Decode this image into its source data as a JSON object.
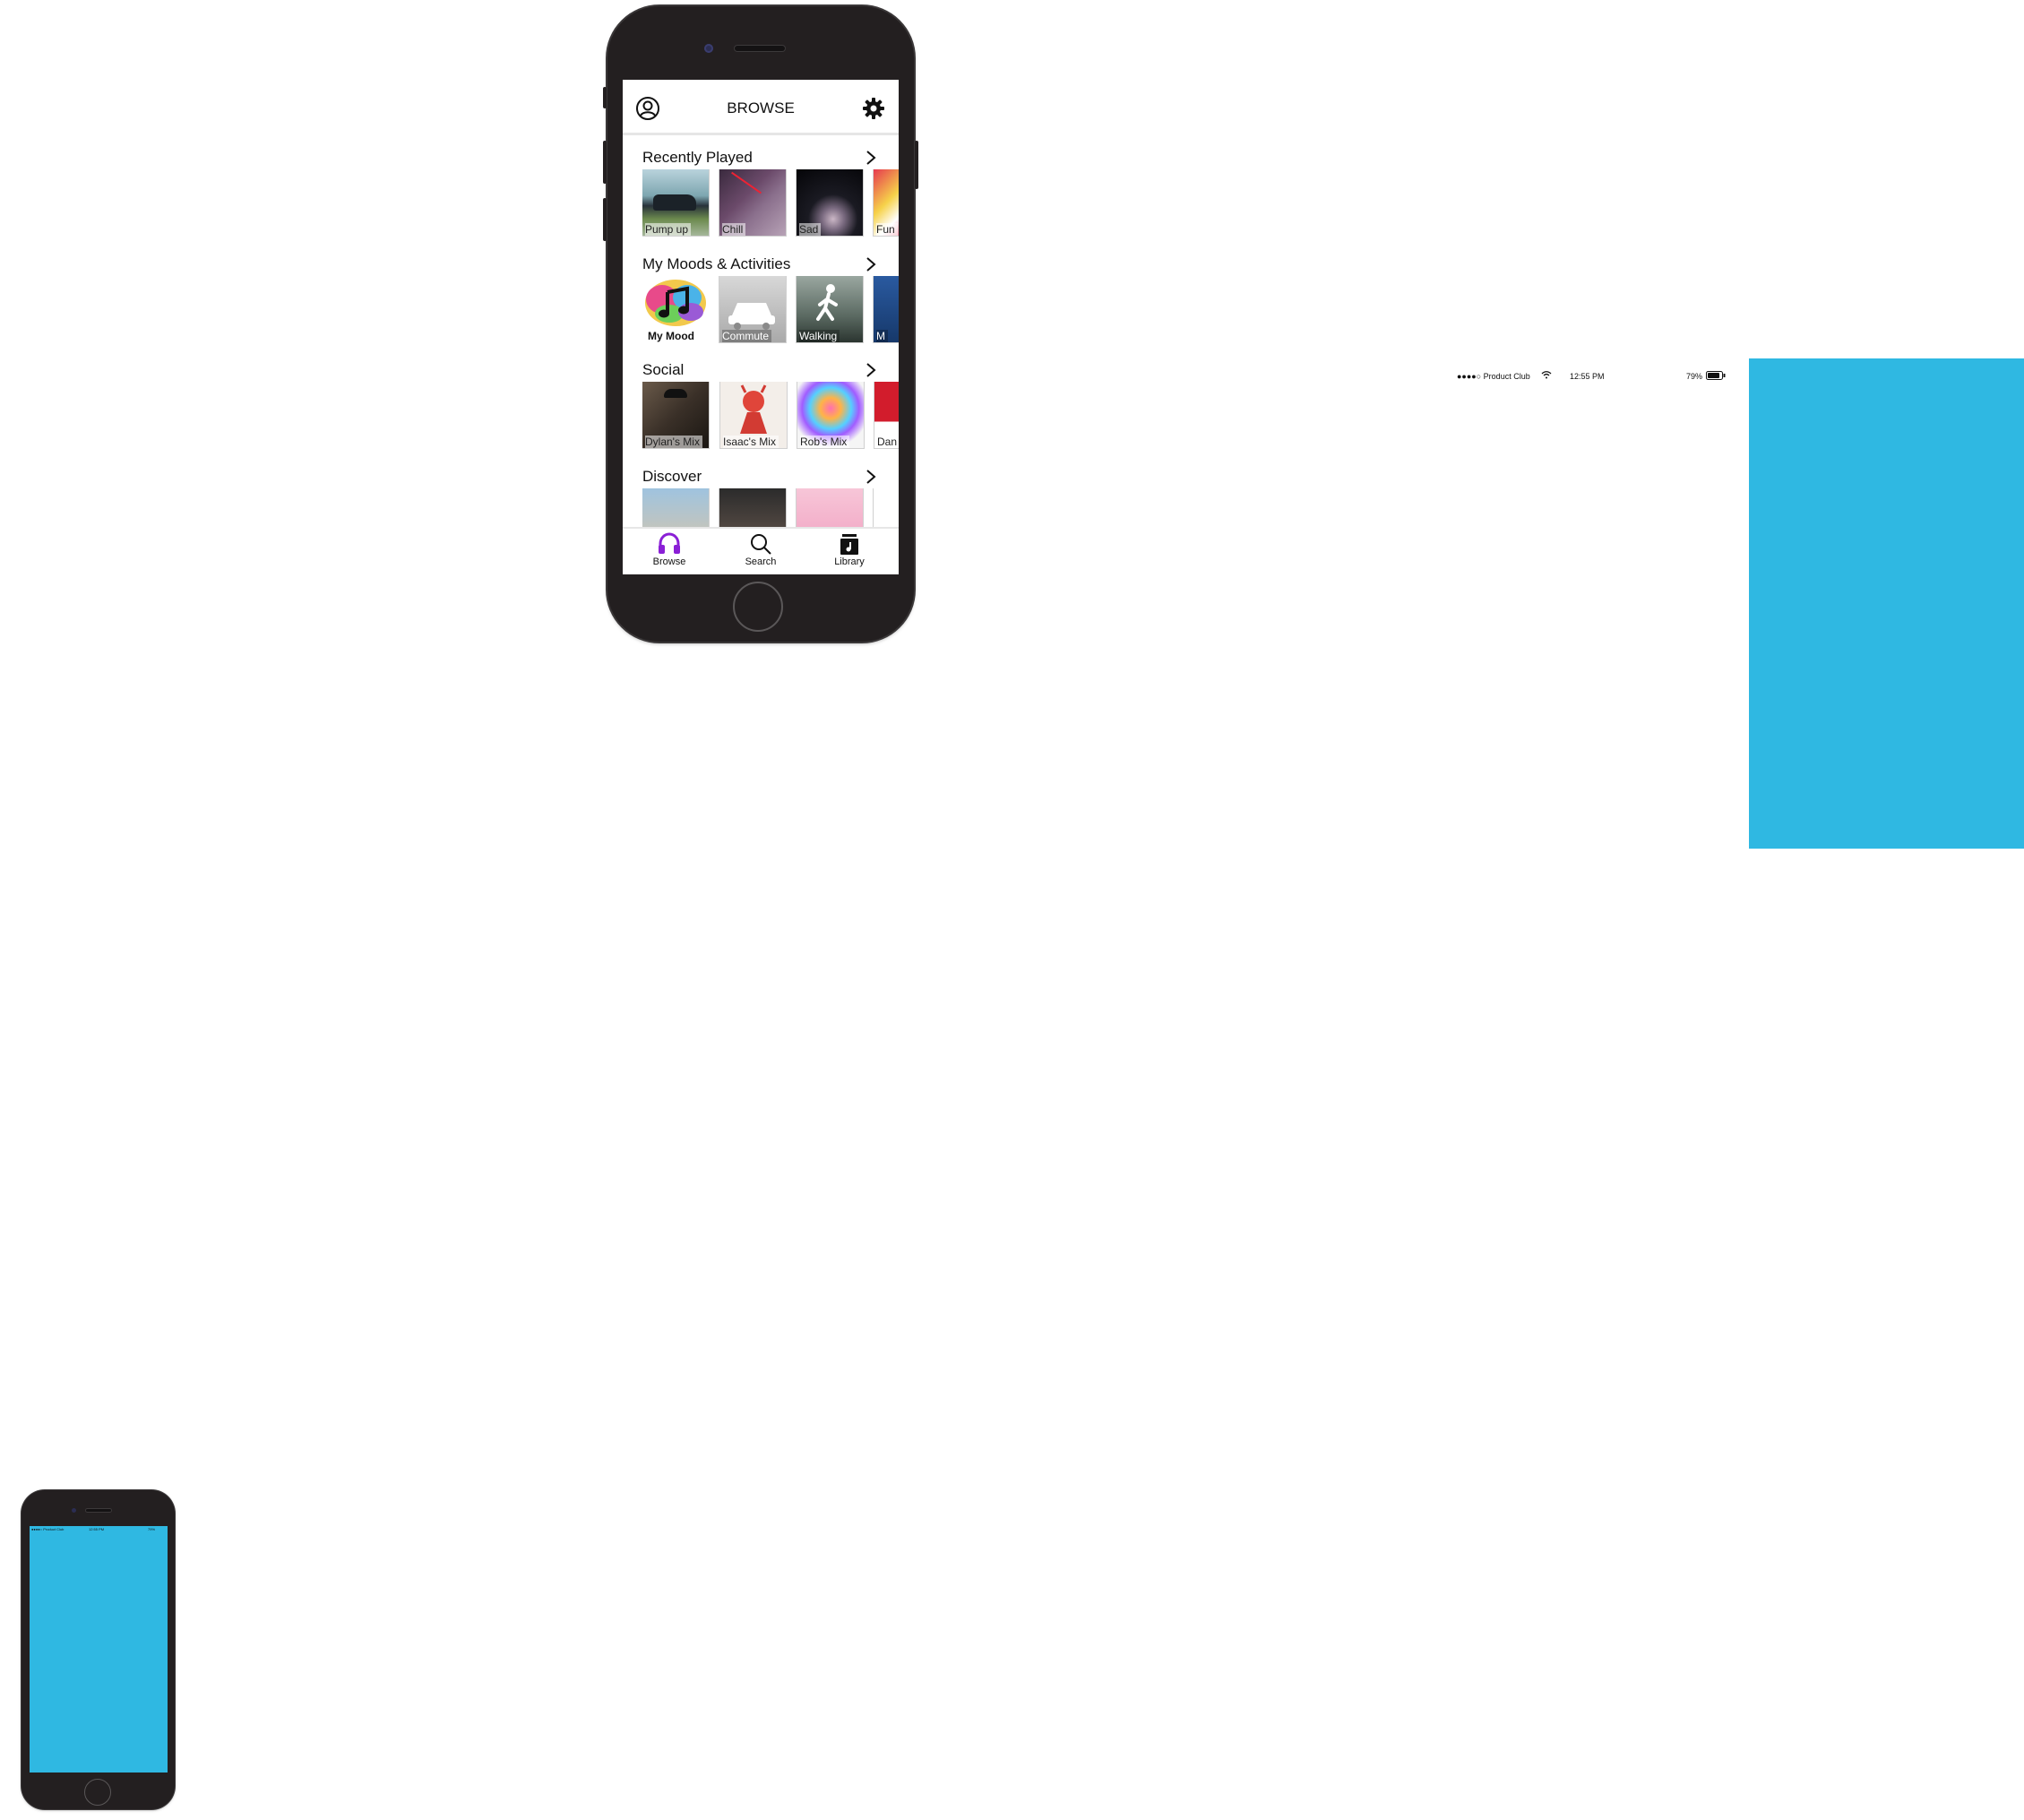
{
  "nav": {
    "title": "BROWSE",
    "left_icon": "user-icon",
    "right_icon": "gear-icon"
  },
  "sections": [
    {
      "title": "Recently Played",
      "tiles": [
        "Pump up",
        "Chill",
        "Sad",
        "Fun"
      ]
    },
    {
      "title": "My Moods & Activities",
      "tiles": [
        "My Mood",
        "Commute",
        "Walking",
        "M"
      ]
    },
    {
      "title": "Social",
      "tiles": [
        "Dylan's Mix",
        "Isaac's Mix",
        "Rob's Mix",
        "Dan"
      ]
    },
    {
      "title": "Discover",
      "tiles": [
        "",
        "",
        "",
        ""
      ]
    }
  ],
  "tabs": [
    {
      "label": "Browse",
      "icon": "headphones-icon",
      "active": true
    },
    {
      "label": "Search",
      "icon": "search-icon",
      "active": false
    },
    {
      "label": "Library",
      "icon": "library-icon",
      "active": false
    }
  ],
  "statusbar": {
    "carrier": "●●●●○ Product Club",
    "time": "12:55 PM",
    "battery": "79%"
  },
  "colors": {
    "accent": "#8a1fd6",
    "panel_blue": "#2fb8e2",
    "phone_body": "#231f20"
  }
}
